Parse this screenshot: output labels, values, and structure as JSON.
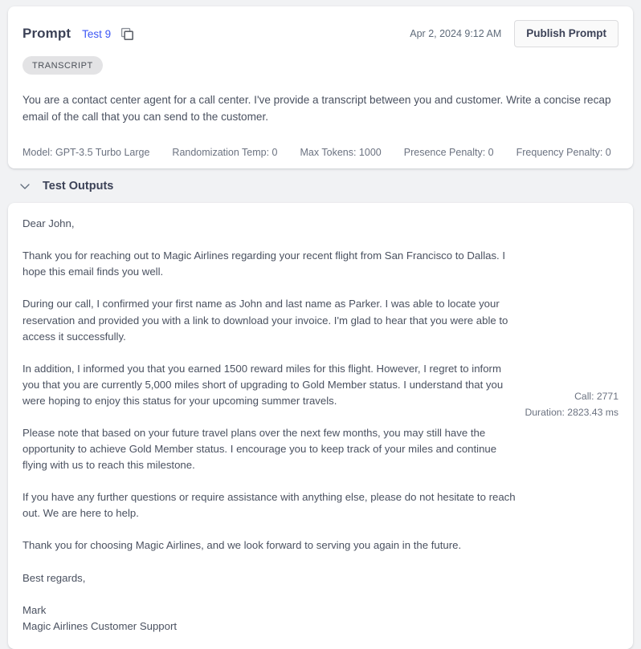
{
  "prompt_card": {
    "title": "Prompt",
    "test_link": "Test 9",
    "copy_icon": "copy-icon",
    "timestamp": "Apr 2, 2024 9:12 AM",
    "publish_button": "Publish Prompt",
    "tag": "TRANSCRIPT",
    "prompt_text": "You are a contact center agent for a call center. I've provide a transcript between you and customer. Write a concise recap email of the call that you can send to the customer.",
    "params": [
      "Model: GPT-3.5 Turbo Large",
      "Randomization Temp: 0",
      "Max Tokens: 1000",
      "Presence Penalty: 0",
      "Frequency Penalty: 0"
    ]
  },
  "outputs_section": {
    "chevron_icon": "chevron-down-icon",
    "title": "Test Outputs",
    "output_text": "Dear John,\n\nThank you for reaching out to Magic Airlines regarding your recent flight from San Francisco to Dallas. I hope this email finds you well.\n\nDuring our call, I confirmed your first name as John and last name as Parker. I was able to locate your reservation and provided you with a link to download your invoice. I'm glad to hear that you were able to access it successfully.\n\nIn addition, I informed you that you earned 1500 reward miles for this flight. However, I regret to inform you that you are currently 5,000 miles short of upgrading to Gold Member status. I understand that you were hoping to enjoy this status for your upcoming summer travels.\n\nPlease note that based on your future travel plans over the next few months, you may still have the opportunity to achieve Gold Member status. I encourage you to keep track of your miles and continue flying with us to reach this milestone.\n\nIf you have any further questions or require assistance with anything else, please do not hesitate to reach out. We are here to help.\n\nThank you for choosing Magic Airlines, and we look forward to serving you again in the future.\n\nBest regards,\n\nMark\nMagic Airlines Customer Support",
    "call_label": "Call: 2771",
    "duration_label": "Duration: 2823.43 ms"
  },
  "colors": {
    "page_background": "#f1f2f4",
    "card_background": "#ffffff",
    "link_blue": "#3c57f5",
    "text_primary": "#3c4257",
    "text_secondary": "#6b7280",
    "tag_background": "#e3e3e5"
  }
}
